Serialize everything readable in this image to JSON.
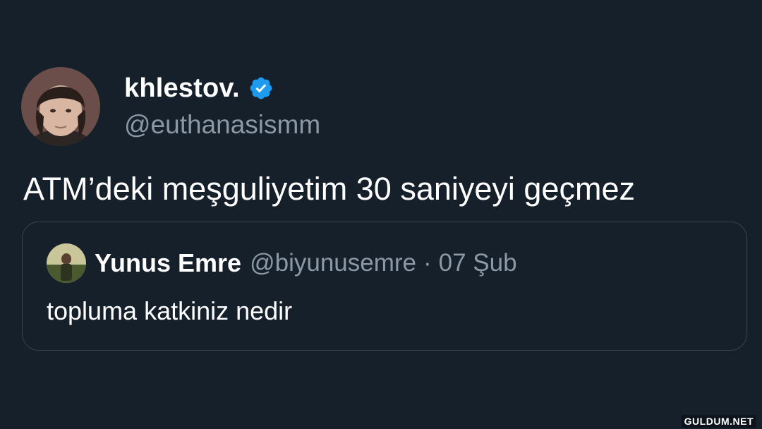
{
  "colors": {
    "background": "#15202b",
    "text_primary": "#ffffff",
    "text_secondary": "#8b98a5",
    "verified_badge": "#1d9bf0",
    "card_border": "#38444d"
  },
  "author": {
    "display_name": "khlestov.",
    "handle": "@euthanasismm",
    "verified_icon": "verified-badge-icon",
    "avatar_icon": "user-avatar"
  },
  "tweet": {
    "text": "ATM’deki meşguliyetim 30 saniyeyi geçmez"
  },
  "quoted_tweet": {
    "display_name": "Yunus Emre",
    "handle": "@biyunusemre",
    "separator": "·",
    "date": "07 Şub",
    "text": "topluma katkiniz nedir",
    "avatar_icon": "user-avatar"
  },
  "watermark": {
    "text": "GULDUM.NET"
  }
}
